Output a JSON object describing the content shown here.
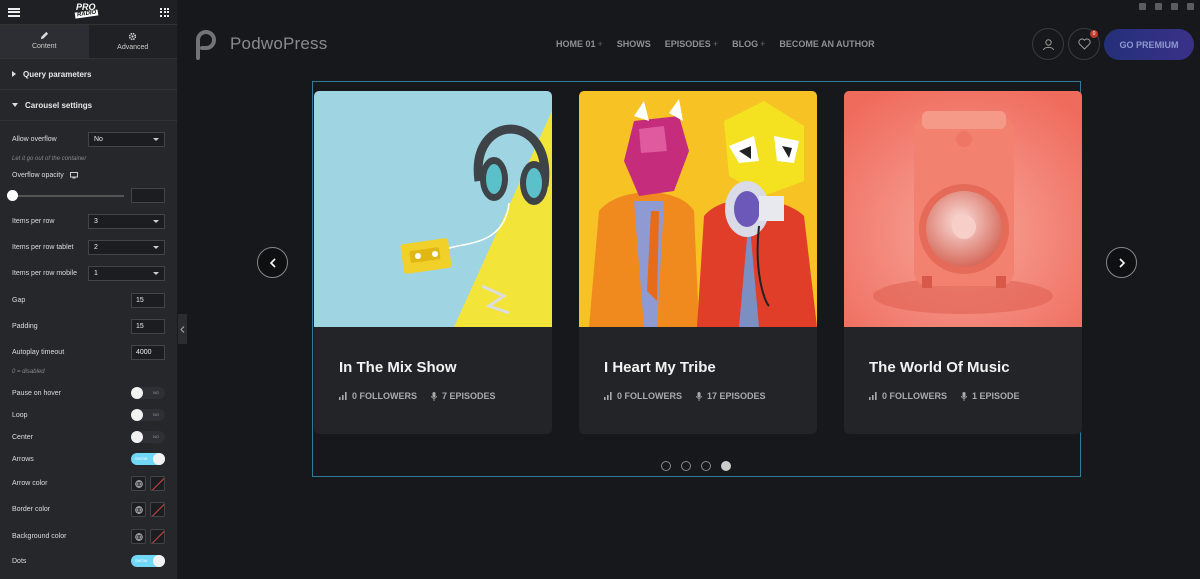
{
  "panel": {
    "tabs": [
      {
        "label": "Content",
        "icon": "pencil-icon"
      },
      {
        "label": "Advanced",
        "icon": "gear-icon"
      }
    ],
    "sections": {
      "query": "Query parameters",
      "carousel": "Carousel settings"
    },
    "fields": {
      "allow_overflow": {
        "label": "Allow overflow",
        "value": "No",
        "hint": "Let it go out of the container"
      },
      "overflow_opacity": {
        "label": "Overflow opacity",
        "value": ""
      },
      "items_per_row": {
        "label": "Items per row",
        "value": "3"
      },
      "items_per_row_tablet": {
        "label": "Items per row tablet",
        "value": "2"
      },
      "items_per_row_mobile": {
        "label": "Items per row mobile",
        "value": "1"
      },
      "gap": {
        "label": "Gap",
        "value": "15"
      },
      "padding": {
        "label": "Padding",
        "value": "15"
      },
      "autoplay_timeout": {
        "label": "Autoplay timeout",
        "value": "4000",
        "hint": "0 = disabled"
      },
      "pause_on_hover": {
        "label": "Pause on hover",
        "state": "NO"
      },
      "loop": {
        "label": "Loop",
        "state": "NO"
      },
      "center": {
        "label": "Center",
        "state": "NO"
      },
      "arrows": {
        "label": "Arrows",
        "state": "SHOW"
      },
      "arrow_color": {
        "label": "Arrow color"
      },
      "border_color": {
        "label": "Border color"
      },
      "background_color": {
        "label": "Background color"
      },
      "dots": {
        "label": "Dots",
        "state": "SHOW"
      }
    }
  },
  "site": {
    "brand": "PodwoPress",
    "nav": [
      {
        "label": "HOME 01",
        "plus": "+"
      },
      {
        "label": "SHOWS",
        "plus": ""
      },
      {
        "label": "EPISODES",
        "plus": "+"
      },
      {
        "label": "BLOG",
        "plus": "+"
      },
      {
        "label": "BECOME AN AUTHOR",
        "plus": ""
      }
    ],
    "favorites_count": "0",
    "premium_label": "GO PREMIUM",
    "accent": "#2d7c9e"
  },
  "cards": [
    {
      "title": "In The Mix Show",
      "followers": "0 FOLLOWERS",
      "episodes": "7 EPISODES"
    },
    {
      "title": "I Heart My Tribe",
      "followers": "0 FOLLOWERS",
      "episodes": "17 EPISODES"
    },
    {
      "title": "The World Of Music",
      "followers": "0 FOLLOWERS",
      "episodes": "1 EPISODE"
    }
  ],
  "carousel": {
    "dot_count": 4,
    "active_dot": 4
  }
}
